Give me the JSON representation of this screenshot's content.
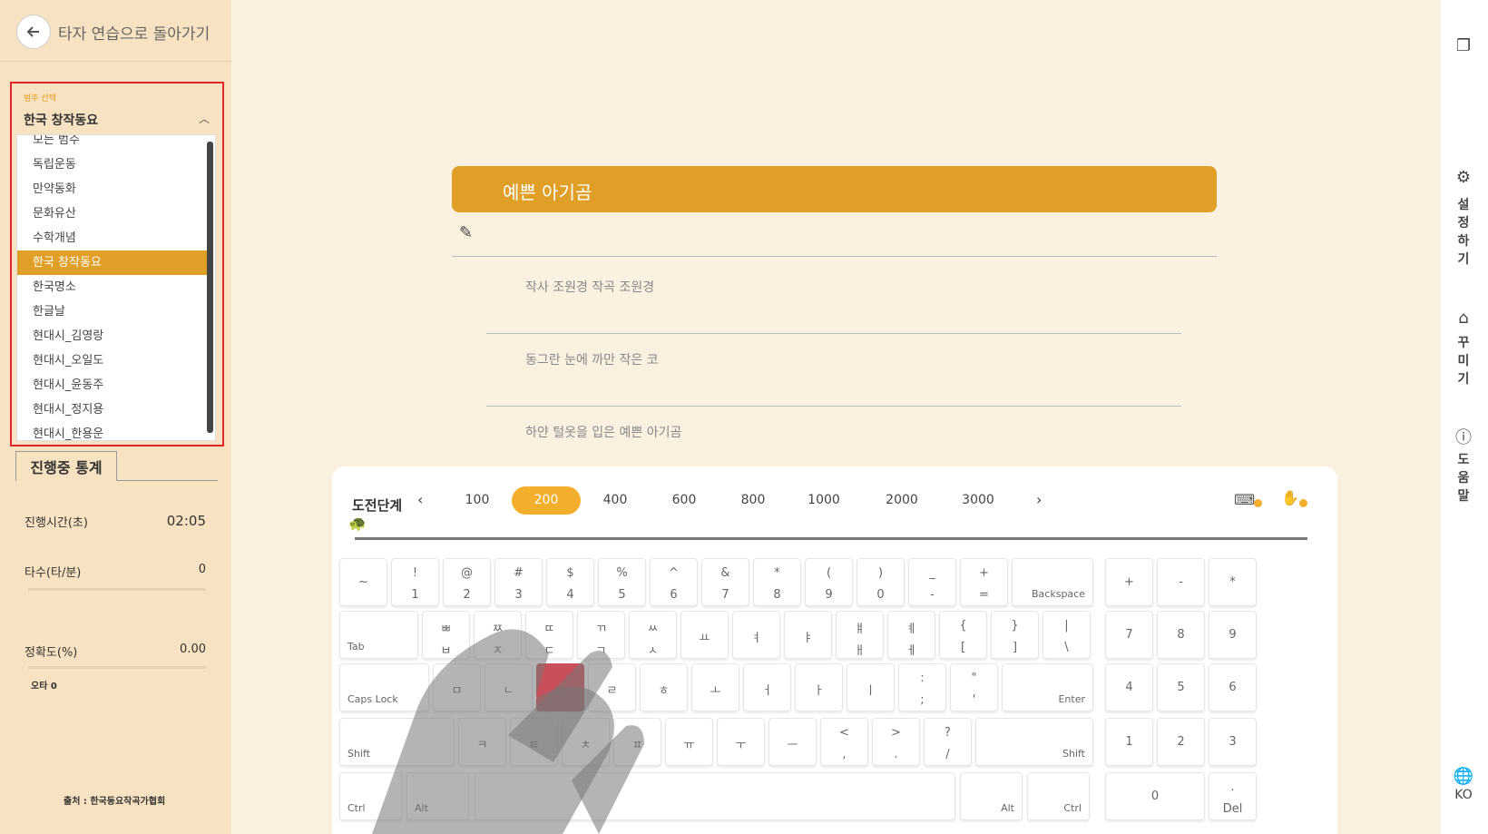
{
  "sidebar": {
    "back_label": "타자 연습으로 돌아가기",
    "category_label": "범주 선택",
    "category_selected": "한국 창작동요",
    "category_items": [
      "모든 범주",
      "독립운동",
      "만약동화",
      "문화유산",
      "수학개념",
      "한국 창작동요",
      "한국명소",
      "한글날",
      "현대시_김영랑",
      "현대시_오일도",
      "현대시_윤동주",
      "현대시_정지용",
      "현대시_한용운"
    ],
    "stats_tab": "진행중 통계",
    "stats": {
      "time_label": "진행시간(초)",
      "time_value": "02:05",
      "speed_label": "타수(타/분)",
      "speed_value": "0",
      "accuracy_label": "정확도(%)",
      "accuracy_value": "0.00",
      "errors": "오타 0"
    },
    "source": "출처 : 한국동요작곡가협회"
  },
  "main": {
    "title": "예쁜 아기곰",
    "lyrics": [
      "작사 조원경 작곡 조원경",
      "동그란 눈에 까만 작은 코",
      "하얀 털옷을 입은 예쁜 아기곰"
    ]
  },
  "challenge": {
    "label": "도전단계",
    "levels": [
      "100",
      "200",
      "400",
      "600",
      "800",
      "1000",
      "2000",
      "3000"
    ],
    "active": "200"
  },
  "keyboard": {
    "row1": [
      [
        "~",
        ""
      ],
      [
        "!",
        "1"
      ],
      [
        "@",
        "2"
      ],
      [
        "#",
        "3"
      ],
      [
        "$",
        "4"
      ],
      [
        "%",
        "5"
      ],
      [
        "^",
        "6"
      ],
      [
        "&",
        "7"
      ],
      [
        "*",
        "8"
      ],
      [
        "(",
        "9"
      ],
      [
        ")",
        "0"
      ],
      [
        "_",
        "-"
      ],
      [
        "+",
        "="
      ]
    ],
    "backspace": "Backspace",
    "tab": "Tab",
    "row2": [
      [
        "ㅃ",
        "ㅂ"
      ],
      [
        "ㅉ",
        "ㅈ"
      ],
      [
        "ㄸ",
        "ㄷ"
      ],
      [
        "ㄲ",
        "ㄱ"
      ],
      [
        "ㅆ",
        "ㅅ"
      ],
      [
        "",
        "ㅛ"
      ],
      [
        "",
        "ㅕ"
      ],
      [
        "",
        "ㅑ"
      ],
      [
        "ㅒ",
        "ㅐ"
      ],
      [
        "ㅖ",
        "ㅔ"
      ],
      [
        "{",
        "["
      ],
      [
        "}",
        "]"
      ],
      [
        "|",
        "\\"
      ]
    ],
    "caps": "Caps Lock",
    "row3": [
      "ㅁ",
      "ㄴ",
      "ㅇ",
      "ㄹ",
      "ㅎ",
      "ㅗ",
      "ㅓ",
      "ㅏ",
      "ㅣ"
    ],
    "row3_punct": [
      [
        ":",
        ";"
      ],
      [
        "\"",
        "'"
      ]
    ],
    "enter": "Enter",
    "shift": "Shift",
    "row4": [
      "ㅋ",
      "ㅌ",
      "ㅊ",
      "ㅍ",
      "ㅠ",
      "ㅜ",
      "ㅡ"
    ],
    "row4_punct": [
      [
        "<",
        ","
      ],
      [
        ">",
        "."
      ],
      [
        "?",
        "/"
      ]
    ],
    "ctrl": "Ctrl",
    "alt": "Alt",
    "numpad": [
      "+",
      "-",
      "*",
      "7",
      "8",
      "9",
      "4",
      "5",
      "6",
      "1",
      "2",
      "3",
      "0"
    ],
    "del_top": ".",
    "del": "Del"
  },
  "rail": {
    "settings": [
      "설",
      "정",
      "하",
      "기"
    ],
    "decorate": [
      "꾸",
      "미",
      "기"
    ],
    "help": [
      "도",
      "움",
      "말"
    ],
    "lang": "KO"
  },
  "colors": {
    "accent": "#E0A027",
    "highlight_key": "#C9505A",
    "outline": "#E0262A"
  }
}
